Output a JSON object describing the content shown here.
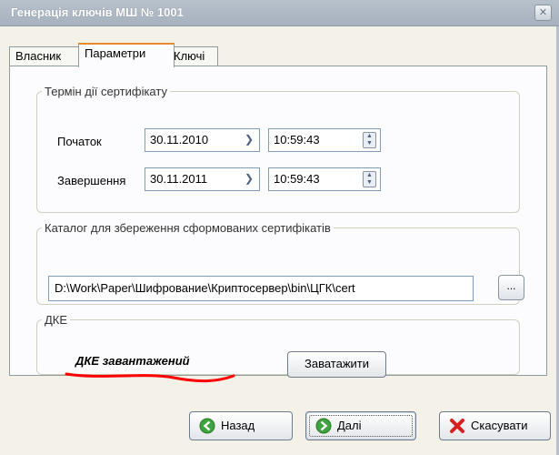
{
  "window": {
    "title": "Генерація ключів МШ № 1001",
    "close_glyph": "✕"
  },
  "tabs": [
    {
      "label": "Власник",
      "active": false
    },
    {
      "label": "Параметри",
      "active": true
    },
    {
      "label": "Ключі",
      "active": false
    }
  ],
  "validity": {
    "legend": "Термін дії сертифікату",
    "start_label": "Початок",
    "start_date": "30.11.2010",
    "start_time": "10:59:43",
    "end_label": "Завершення",
    "end_date": "30.11.2011",
    "end_time": "10:59:43"
  },
  "catalog": {
    "legend": "Каталог для збереження сформованих сертифікатів",
    "path": "D:\\Work\\Paper\\Шифрование\\Криптосервер\\bin\\ЦГК\\cert",
    "browse_label": "..."
  },
  "dke": {
    "legend": "ДКЕ",
    "status": "ДКЕ завантажений",
    "reload_label": "Заватажити"
  },
  "buttons": {
    "back": "Назад",
    "next": "Далі",
    "cancel": "Скасувати"
  },
  "colors": {
    "active_tab_accent": "#e68b2c",
    "annotation_red": "#ff0000"
  }
}
